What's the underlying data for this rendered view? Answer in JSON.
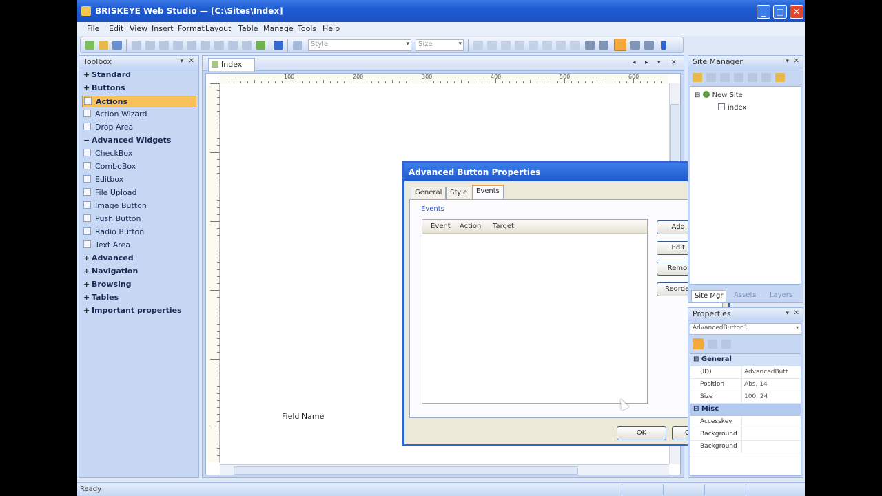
{
  "window": {
    "title": "BRISKEYE Web Studio — [C:\\Sites\\Index]",
    "min_glyph": "_",
    "max_glyph": "□",
    "close_glyph": "✕"
  },
  "menubar": [
    "File",
    "Edit",
    "View",
    "Insert",
    "Format",
    "Layout",
    "Table",
    "Manage",
    "Tools",
    "Help"
  ],
  "toolbar": {
    "combo1": "Style",
    "combo2": "Size"
  },
  "toolbox": {
    "title": "Toolbox",
    "pin": "▾",
    "close": "✕",
    "entries": [
      {
        "kind": "group",
        "sign": "+",
        "label": "Standard"
      },
      {
        "kind": "group",
        "sign": "+",
        "label": "Buttons"
      },
      {
        "kind": "selected",
        "sign": "−",
        "label": "Actions"
      },
      {
        "kind": "item",
        "label": "Action Wizard"
      },
      {
        "kind": "item",
        "label": "Drop Area"
      },
      {
        "kind": "group",
        "sign": "−",
        "label": "Advanced Widgets"
      },
      {
        "kind": "item",
        "label": "CheckBox"
      },
      {
        "kind": "item",
        "label": "ComboBox"
      },
      {
        "kind": "item",
        "label": "Editbox"
      },
      {
        "kind": "item",
        "label": "File Upload"
      },
      {
        "kind": "item",
        "label": "Image Button"
      },
      {
        "kind": "item",
        "label": "Push Button"
      },
      {
        "kind": "item",
        "label": "Radio Button"
      },
      {
        "kind": "item",
        "label": "Text Area"
      },
      {
        "kind": "group",
        "sign": "+",
        "label": "Advanced"
      },
      {
        "kind": "group",
        "sign": "+",
        "label": "Navigation"
      },
      {
        "kind": "group",
        "sign": "+",
        "label": "Browsing"
      },
      {
        "kind": "group",
        "sign": "+",
        "label": "Tables"
      },
      {
        "kind": "group",
        "sign": "+",
        "label": "Important properties"
      }
    ]
  },
  "document": {
    "tab_label": "Index",
    "ruler_numbers": [
      "100",
      "200",
      "300",
      "400",
      "500",
      "600"
    ],
    "form_label": "Field Name"
  },
  "dialog": {
    "title": "Advanced Button Properties",
    "close": "✕",
    "tabs": [
      "General",
      "Style",
      "Events"
    ],
    "active_tab": "Events",
    "group_label": "Events",
    "columns": [
      "Event",
      "Action",
      "Target"
    ],
    "buttons": [
      "Add...",
      "Edit...",
      "Remove",
      "Reorder..."
    ],
    "ok": "OK",
    "cancel": "Cancel"
  },
  "site_manager": {
    "title": "Site Manager",
    "pin": "▾",
    "close": "✕",
    "tree_root": "New Site",
    "tree_child": "index",
    "tabs": [
      "Site Mgr",
      "Assets",
      "Layers"
    ]
  },
  "properties": {
    "title": "Properties",
    "pin": "▾",
    "close": "✕",
    "selected": "AdvancedButton1",
    "categories": [
      "General",
      "Misc"
    ],
    "rows": [
      {
        "key": "(ID)",
        "value": "AdvancedButt"
      },
      {
        "key": "Position",
        "value": "Abs, 14"
      },
      {
        "key": "Size",
        "value": "100, 24"
      },
      {
        "key": "Accesskey",
        "value": ""
      },
      {
        "key": "Background",
        "value": ""
      },
      {
        "key": "Background",
        "value": ""
      }
    ]
  },
  "statusbar": {
    "text": "Ready"
  },
  "colors": {
    "accent": "#2c65d7",
    "selection": "#f8c15a"
  }
}
